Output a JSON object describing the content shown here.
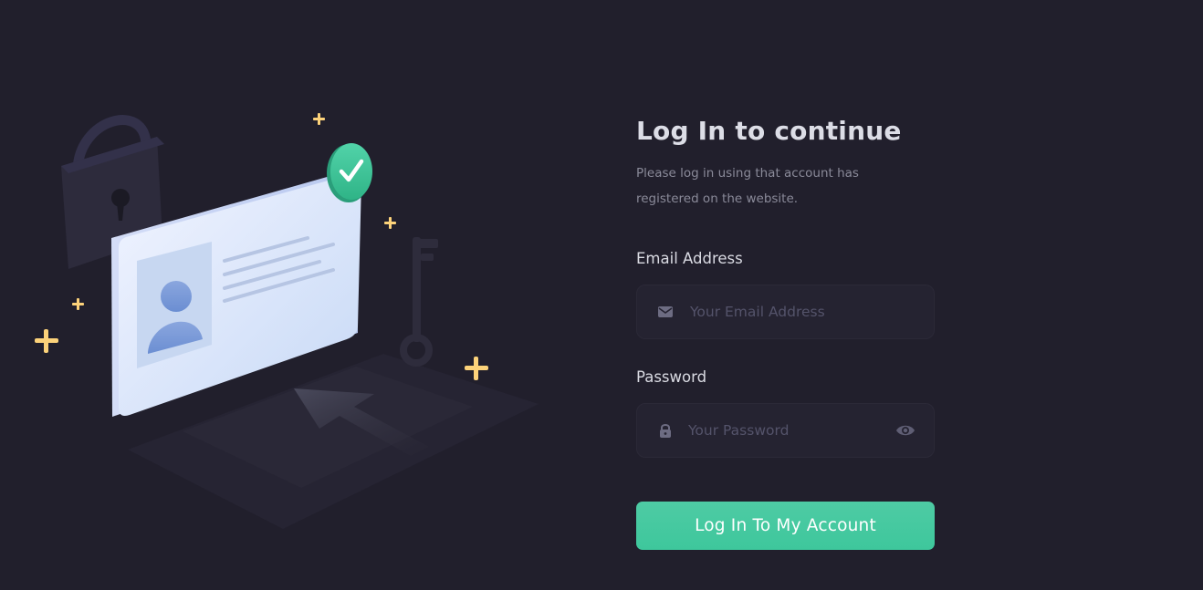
{
  "login": {
    "title": "Log In to continue",
    "subtitle": "Please log in using that account has registered on the website.",
    "email_label": "Email Address",
    "email_placeholder": "Your Email Address",
    "email_icon": "mail-icon",
    "password_label": "Password",
    "password_placeholder": "Your Password",
    "password_icon": "lock-icon",
    "visibility_icon": "eye-icon",
    "submit_label": "Log In To My Account"
  },
  "illustration": {
    "icons": [
      "padlock-icon",
      "id-card-icon",
      "checkmark-badge-icon",
      "key-icon",
      "cursor-arrow-icon",
      "sparkle-icon"
    ]
  },
  "colors": {
    "background": "#211f2c",
    "field_background": "#252331",
    "accent": "#41c79c",
    "sparkle": "#fcd27a",
    "card": "#dbe6f8",
    "title_text": "#dcdde6",
    "muted_text": "#8a8a99"
  }
}
